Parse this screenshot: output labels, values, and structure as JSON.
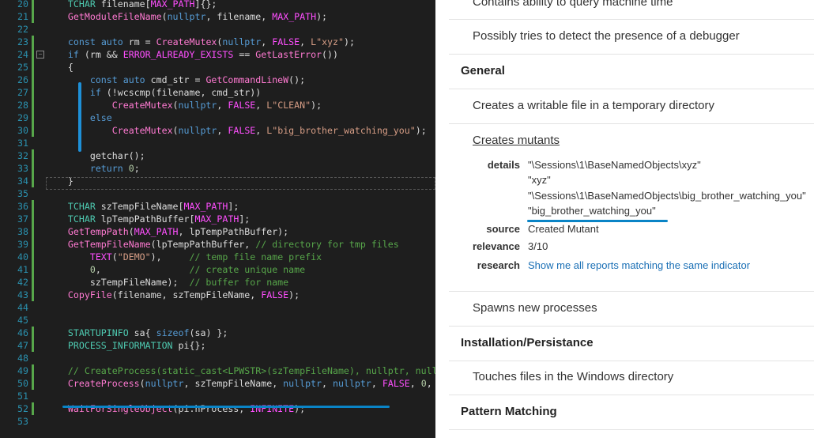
{
  "editor": {
    "lines": [
      {
        "n": "20",
        "h": "    <span class='tp'>TCHAR</span> filename[<span class='mac'>MAX_PATH</span>]{};"
      },
      {
        "n": "21",
        "h": "    <span class='fn'>GetModuleFileName</span>(<span class='kw'>nullptr</span>, filename, <span class='mac'>MAX_PATH</span>);"
      },
      {
        "n": "22",
        "h": ""
      },
      {
        "n": "23",
        "h": "    <span class='kw'>const</span> <span class='kw'>auto</span> rm = <span class='fn'>CreateMutex</span>(<span class='kw'>nullptr</span>, <span class='mac'>FALSE</span>, <span class='str'>L\"xyz\"</span>);"
      },
      {
        "n": "24",
        "h": "    <span class='kw'>if</span> (rm &amp;&amp; <span class='mac'>ERROR_ALREADY_EXISTS</span> == <span class='fn'>GetLastError</span>())"
      },
      {
        "n": "25",
        "h": "    {"
      },
      {
        "n": "26",
        "h": "        <span class='kw'>const</span> <span class='kw'>auto</span> cmd_str = <span class='fn'>GetCommandLineW</span>();"
      },
      {
        "n": "27",
        "h": "        <span class='kw'>if</span> (!wcscmp(filename, cmd_str))"
      },
      {
        "n": "28",
        "h": "            <span class='fn'>CreateMutex</span>(<span class='kw'>nullptr</span>, <span class='mac'>FALSE</span>, <span class='str'>L\"CLEAN\"</span>);"
      },
      {
        "n": "29",
        "h": "        <span class='kw'>else</span>"
      },
      {
        "n": "30",
        "h": "            <span class='fn'>CreateMutex</span>(<span class='kw'>nullptr</span>, <span class='mac'>FALSE</span>, <span class='str'>L\"big_brother_watching_you\"</span>);"
      },
      {
        "n": "31",
        "h": ""
      },
      {
        "n": "32",
        "h": "        getchar();"
      },
      {
        "n": "33",
        "h": "        <span class='kw'>return</span> <span class='num'>0</span>;"
      },
      {
        "n": "34",
        "h": "    }"
      },
      {
        "n": "35",
        "h": ""
      },
      {
        "n": "36",
        "h": "    <span class='tp'>TCHAR</span> szTempFileName[<span class='mac'>MAX_PATH</span>];"
      },
      {
        "n": "37",
        "h": "    <span class='tp'>TCHAR</span> lpTempPathBuffer[<span class='mac'>MAX_PATH</span>];"
      },
      {
        "n": "38",
        "h": "    <span class='fn'>GetTempPath</span>(<span class='mac'>MAX_PATH</span>, lpTempPathBuffer);"
      },
      {
        "n": "39",
        "h": "    <span class='fn'>GetTempFileName</span>(lpTempPathBuffer, <span class='cm'>// directory for tmp files</span>"
      },
      {
        "n": "40",
        "h": "        <span class='mac'>TEXT</span>(<span class='str'>\"DEMO\"</span>),     <span class='cm'>// temp file name prefix</span>"
      },
      {
        "n": "41",
        "h": "        <span class='num'>0</span>,                <span class='cm'>// create unique name</span>"
      },
      {
        "n": "42",
        "h": "        szTempFileName);  <span class='cm'>// buffer for name</span>"
      },
      {
        "n": "43",
        "h": "    <span class='fn'>CopyFile</span>(filename, szTempFileName, <span class='mac'>FALSE</span>);"
      },
      {
        "n": "44",
        "h": ""
      },
      {
        "n": "45",
        "h": ""
      },
      {
        "n": "46",
        "h": "    <span class='tp'>STARTUPINFO</span> sa{ <span class='kw'>sizeof</span>(sa) };"
      },
      {
        "n": "47",
        "h": "    <span class='tp'>PROCESS_INFORMATION</span> pi{};"
      },
      {
        "n": "48",
        "h": ""
      },
      {
        "n": "49",
        "h": "    <span class='cm'>// CreateProcess(static_cast&lt;LPWSTR&gt;(szTempFileName), nullptr, null</span>"
      },
      {
        "n": "50",
        "h": "    <span class='fn'>CreateProcess</span>(<span class='kw'>nullptr</span>, szTempFileName, <span class='kw'>nullptr</span>, <span class='kw'>nullptr</span>, <span class='mac'>FALSE</span>, <span class='num'>0</span>,"
      },
      {
        "n": "51",
        "h": ""
      },
      {
        "n": "52",
        "h": "    <span class='fn'>WaitForSingleObject</span>(pi.hProcess, <span class='mac'>INFINITE</span>);"
      },
      {
        "n": "53",
        "h": ""
      }
    ]
  },
  "report": {
    "top_item": "Contains ability to query machine time",
    "debugger_item": "Possibly tries to detect the presence of a debugger",
    "section_general": "General",
    "temp_item": "Creates a writable file in a temporary directory",
    "mutants_item": "Creates mutants",
    "details_label": "details",
    "details": [
      "\"\\Sessions\\1\\BaseNamedObjects\\xyz\"",
      "\"xyz\"",
      "\"\\Sessions\\1\\BaseNamedObjects\\big_brother_watching_you\"",
      "\"big_brother_watching_you\""
    ],
    "source_label": "source",
    "source_value": "Created Mutant",
    "relevance_label": "relevance",
    "relevance_value": "3/10",
    "research_label": "research",
    "research_link": "Show me all reports matching the same indicator",
    "spawns_item": "Spawns new processes",
    "section_install": "Installation/Persistance",
    "windows_dir_item": "Touches files in the Windows directory",
    "section_pattern": "Pattern Matching"
  }
}
